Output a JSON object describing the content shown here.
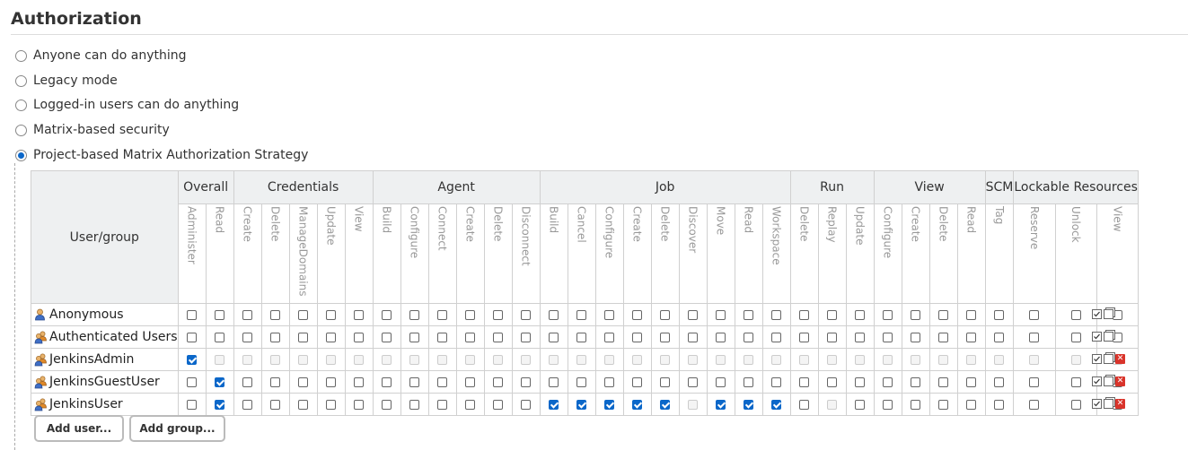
{
  "section": {
    "title": "Authorization"
  },
  "strategies": [
    {
      "label": "Anyone can do anything",
      "selected": false
    },
    {
      "label": "Legacy mode",
      "selected": false
    },
    {
      "label": "Logged-in users can do anything",
      "selected": false
    },
    {
      "label": "Matrix-based security",
      "selected": false
    },
    {
      "label": "Project-based Matrix Authorization Strategy",
      "selected": true
    }
  ],
  "matrix": {
    "user_group_header": "User/group",
    "groups": [
      {
        "name": "Overall",
        "permissions": [
          "Administer",
          "Read"
        ]
      },
      {
        "name": "Credentials",
        "permissions": [
          "Create",
          "Delete",
          "ManageDomains",
          "Update",
          "View"
        ]
      },
      {
        "name": "Agent",
        "permissions": [
          "Build",
          "Configure",
          "Connect",
          "Create",
          "Delete",
          "Disconnect"
        ]
      },
      {
        "name": "Job",
        "permissions": [
          "Build",
          "Cancel",
          "Configure",
          "Create",
          "Delete",
          "Discover",
          "Move",
          "Read",
          "Workspace"
        ]
      },
      {
        "name": "Run",
        "permissions": [
          "Delete",
          "Replay",
          "Update"
        ]
      },
      {
        "name": "View",
        "permissions": [
          "Configure",
          "Create",
          "Delete",
          "Read"
        ]
      },
      {
        "name": "SCM",
        "permissions": [
          "Tag"
        ]
      },
      {
        "name": "Lockable Resources",
        "permissions": [
          "Reserve",
          "Unlock",
          "View"
        ]
      }
    ],
    "rows": [
      {
        "name": "Anonymous",
        "kind": "user",
        "deletable": false,
        "values": [
          "0",
          "0",
          "0",
          "0",
          "0",
          "0",
          "0",
          "0",
          "0",
          "0",
          "0",
          "0",
          "0",
          "0",
          "0",
          "0",
          "0",
          "0",
          "0",
          "0",
          "0",
          "0",
          "0",
          "0",
          "0",
          "0",
          "0",
          "0",
          "0",
          "0",
          "0",
          "0",
          "0"
        ]
      },
      {
        "name": "Authenticated Users",
        "kind": "group",
        "deletable": false,
        "values": [
          "0",
          "0",
          "0",
          "0",
          "0",
          "0",
          "0",
          "0",
          "0",
          "0",
          "0",
          "0",
          "0",
          "0",
          "0",
          "0",
          "0",
          "0",
          "0",
          "0",
          "0",
          "0",
          "0",
          "0",
          "0",
          "0",
          "0",
          "0",
          "0",
          "0",
          "0",
          "0",
          "0"
        ]
      },
      {
        "name": "JenkinsAdmin",
        "kind": "group",
        "deletable": true,
        "values": [
          "1",
          "d",
          "d",
          "d",
          "d",
          "d",
          "d",
          "d",
          "d",
          "d",
          "d",
          "d",
          "d",
          "d",
          "d",
          "d",
          "d",
          "d",
          "d",
          "d",
          "d",
          "d",
          "d",
          "d",
          "d",
          "d",
          "d",
          "d",
          "d",
          "d",
          "d",
          "d",
          "d"
        ]
      },
      {
        "name": "JenkinsGuestUser",
        "kind": "group",
        "deletable": true,
        "values": [
          "0",
          "1",
          "0",
          "0",
          "0",
          "0",
          "0",
          "0",
          "0",
          "0",
          "0",
          "0",
          "0",
          "0",
          "0",
          "0",
          "0",
          "0",
          "0",
          "0",
          "0",
          "0",
          "0",
          "0",
          "0",
          "0",
          "0",
          "0",
          "0",
          "0",
          "0",
          "0",
          "0"
        ]
      },
      {
        "name": "JenkinsUser",
        "kind": "group",
        "deletable": true,
        "values": [
          "0",
          "1",
          "0",
          "0",
          "0",
          "0",
          "0",
          "0",
          "0",
          "0",
          "0",
          "0",
          "0",
          "1",
          "1",
          "1",
          "1",
          "1",
          "d",
          "1",
          "1",
          "1",
          "0",
          "d",
          "0",
          "0",
          "0",
          "0",
          "0",
          "0",
          "0",
          "0",
          "0"
        ]
      }
    ]
  },
  "buttons": {
    "add_user": "Add user...",
    "add_group": "Add group..."
  },
  "colors": {
    "accent": "#0b67c9",
    "header_bg": "#eef0f1",
    "delete": "#d9342b"
  },
  "icons": {
    "user": "user-icon",
    "group": "group-icon",
    "select_all": "select-all-icon",
    "copy": "copy-icon",
    "delete": "delete-icon"
  }
}
